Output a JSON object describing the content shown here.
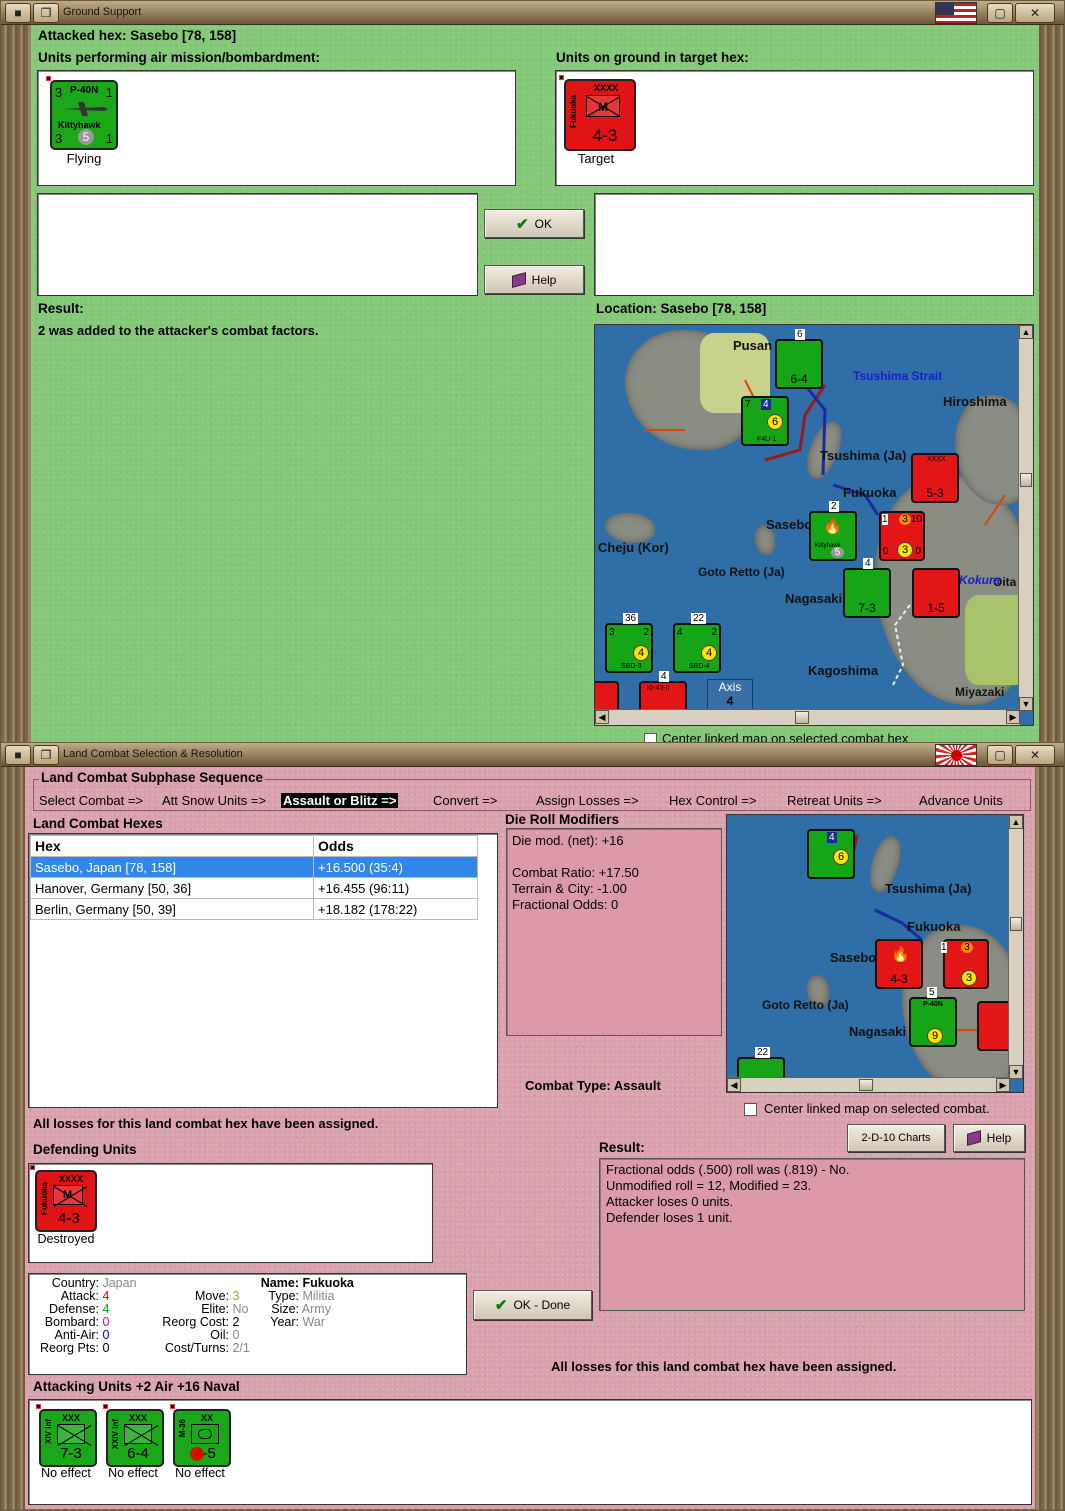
{
  "top_window": {
    "title": "Ground Support",
    "attacked_hex": "Attacked hex: Sasebo  [78, 158]",
    "units_air_label": "Units performing air mission/bombardment:",
    "units_ground_label": "Units on ground in target hex:",
    "air_unit": {
      "name": "P-40N",
      "sub": "Kittyhawk",
      "top_left": "3",
      "top_right": "1",
      "bot_left": "3",
      "bot_mid": "5",
      "bot_right": "1",
      "caption": "Flying"
    },
    "ground_unit": {
      "size": "XXXX",
      "type": "M",
      "side": "Fukuoka",
      "value": "4-3",
      "caption": "Target"
    },
    "ok_label": "OK",
    "help_label": "Help",
    "result_label": "Result:",
    "result_text": "2 was added to the attacker's combat factors.",
    "location_label": "Location:  Sasebo  [78, 158]",
    "center_label": "Center linked map on selected combat hex",
    "map": {
      "labels": [
        "Pusan",
        "Tsushima Strait",
        "Hiroshima",
        "Tsushima (Ja)",
        "Fukuoka",
        "Sasebo",
        "Cheju (Kor)",
        "Goto Retto (Ja)",
        "Nagasaki",
        "Kagoshima",
        "Miyazaki",
        "Oita",
        "Kokura"
      ],
      "counters": {
        "c1": {
          "num": "6",
          "val": "6-4"
        },
        "c2": {
          "num": "4",
          "tl": "7",
          "yc": "6",
          "sub": "F4U-1"
        },
        "c3": {
          "num": "5-3",
          "size": "XXXX"
        },
        "c4": {
          "num": "2",
          "sub": "Kittyhawk",
          "mid": "5"
        },
        "c5": {
          "a": "1",
          "b": "3",
          "c": "10",
          "d": "0",
          "e": "3",
          "f": "0"
        },
        "c6": {
          "num": "4",
          "val": "7-3"
        },
        "c7": {
          "val": "1-5"
        },
        "c8": {
          "num": "36",
          "tl": "3",
          "tr": "2",
          "yc": "4",
          "sub": "SBD-3"
        },
        "c9": {
          "num": "22",
          "tl": "4",
          "tr": "2",
          "yc": "4",
          "sub": "SBD-4"
        },
        "c10": {
          "num": "4",
          "sub": "Ki-43-II"
        },
        "axis": {
          "label": "Axis",
          "num": "4"
        }
      }
    }
  },
  "bottom_window": {
    "title": "Land Combat Selection & Resolution",
    "sequence_label": "Land Combat Subphase Sequence",
    "sequence": [
      "Select Combat =>",
      "Att Snow Units =>",
      "Assault or Blitz =>",
      "Convert =>",
      "Assign Losses =>",
      "Hex Control =>",
      "Retreat Units =>",
      "Advance Units"
    ],
    "hexes_label": "Land Combat Hexes",
    "columns": [
      "Hex",
      "Odds"
    ],
    "rows": [
      {
        "hex": "Sasebo, Japan [78, 158]",
        "odds": "+16.500 (35:4)"
      },
      {
        "hex": "Hanover, Germany [50, 36]",
        "odds": "+16.455 (96:11)"
      },
      {
        "hex": "Berlin, Germany [50, 39]",
        "odds": "+18.182 (178:22)"
      }
    ],
    "drm_label": "Die Roll Modifiers",
    "drm_lines": [
      "Die mod. (net): +16",
      "",
      "Combat Ratio: +17.50",
      "Terrain & City: -1.00",
      "Fractional Odds: 0"
    ],
    "combat_type": "Combat Type:  Assault",
    "losses_text": "All losses for this land combat hex have been assigned.",
    "center_label": "Center linked map on selected combat.",
    "charts_label": "2-D-10 Charts",
    "help_label": "Help",
    "defending_label": "Defending Units",
    "defender": {
      "size": "XXXX",
      "type": "M",
      "side": "Fukuoka",
      "value": "4-3",
      "caption": "Destroyed"
    },
    "result_label": "Result:",
    "result_lines": [
      "Fractional odds (.500) roll was (.819)  - No.",
      "Unmodified roll = 12, Modified = 23.",
      "Attacker loses 0 units.",
      "Defender loses 1 unit."
    ],
    "ok_done_label": "OK - Done",
    "losses_text2": "All losses for this land combat hex have been assigned.",
    "info": {
      "country_k": "Country:",
      "country_v": "Japan",
      "attack_k": "Attack:",
      "attack_v": "4",
      "defense_k": "Defense:",
      "defense_v": "4",
      "bombard_k": "Bombard:",
      "bombard_v": "0",
      "antiair_k": "Anti-Air:",
      "antiair_v": "0",
      "reorgpts_k": "Reorg Pts:",
      "reorgpts_v": "0",
      "move_k": "Move:",
      "move_v": "3",
      "elite_k": "Elite:",
      "elite_v": "No",
      "reorgcost_k": "Reorg Cost:",
      "reorgcost_v": "2",
      "oil_k": "Oil:",
      "oil_v": "0",
      "cost_k": "Cost/Turns:",
      "cost_v": "2/1",
      "name_k": "Name:",
      "name_v": "Fukuoka",
      "type_k": "Type:",
      "type_v": "Militia",
      "size_k": "Size:",
      "size_v": "Army",
      "year_k": "Year:",
      "year_v": "War"
    },
    "attacking_label": "Attacking Units +2 Air +16 Naval",
    "attackers": [
      {
        "size": "XXX",
        "side": "XIV Inf",
        "value": "7-3",
        "caption": "No effect"
      },
      {
        "size": "XXX",
        "side": "XXIV Inf",
        "value": "6-4",
        "caption": "No effect"
      },
      {
        "size": "XX",
        "side": "M-36",
        "value": "4-5",
        "caption": "No effect"
      }
    ],
    "map": {
      "labels": [
        "Tsushima (Ja)",
        "Fukuoka",
        "Sasebo",
        "Goto Retto (Ja)",
        "Nagasaki"
      ],
      "counters": {
        "a": "4",
        "b": "6",
        "c": "1",
        "d": "3",
        "e": "5",
        "f": "P-40N",
        "g": "9",
        "h": "22",
        "i": "4-3",
        "j": "3"
      }
    }
  }
}
